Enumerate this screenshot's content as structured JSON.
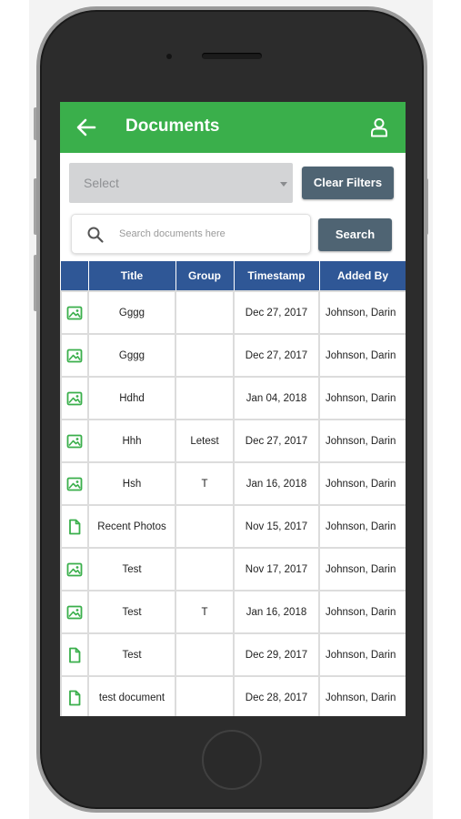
{
  "header": {
    "title": "Documents",
    "back_icon": "arrow-left-icon",
    "profile_icon": "user-icon"
  },
  "filters": {
    "select_value": "Select",
    "clear_label": "Clear Filters"
  },
  "search": {
    "placeholder": "Search documents here",
    "button_label": "Search"
  },
  "colors": {
    "header_bg": "#3aaf4b",
    "table_header_bg": "#2f5796",
    "button_bg": "#4f6473",
    "icon_green": "#3aaf4b"
  },
  "table": {
    "columns": [
      "Title",
      "Group",
      "Timestamp",
      "Added By"
    ],
    "rows": [
      {
        "icon": "image-icon",
        "title": "Gggg",
        "group": "",
        "timestamp": "Dec 27, 2017",
        "added_by": "Johnson, Darin"
      },
      {
        "icon": "image-icon",
        "title": "Gggg",
        "group": "",
        "timestamp": "Dec 27, 2017",
        "added_by": "Johnson, Darin"
      },
      {
        "icon": "image-icon",
        "title": "Hdhd",
        "group": "",
        "timestamp": "Jan 04, 2018",
        "added_by": "Johnson, Darin"
      },
      {
        "icon": "image-icon",
        "title": "Hhh",
        "group": "Letest",
        "timestamp": "Dec 27, 2017",
        "added_by": "Johnson, Darin"
      },
      {
        "icon": "image-icon",
        "title": "Hsh",
        "group": "T",
        "timestamp": "Jan 16, 2018",
        "added_by": "Johnson, Darin"
      },
      {
        "icon": "file-icon",
        "title": "Recent Photos",
        "group": "",
        "timestamp": "Nov 15, 2017",
        "added_by": "Johnson, Darin"
      },
      {
        "icon": "image-icon",
        "title": "Test",
        "group": "",
        "timestamp": "Nov 17, 2017",
        "added_by": "Johnson, Darin"
      },
      {
        "icon": "image-icon",
        "title": "Test",
        "group": "T",
        "timestamp": "Jan 16, 2018",
        "added_by": "Johnson, Darin"
      },
      {
        "icon": "file-icon",
        "title": "Test",
        "group": "",
        "timestamp": "Dec 29, 2017",
        "added_by": "Johnson, Darin"
      },
      {
        "icon": "file-icon",
        "title": "test document",
        "group": "",
        "timestamp": "Dec 28, 2017",
        "added_by": "Johnson, Darin"
      }
    ]
  }
}
